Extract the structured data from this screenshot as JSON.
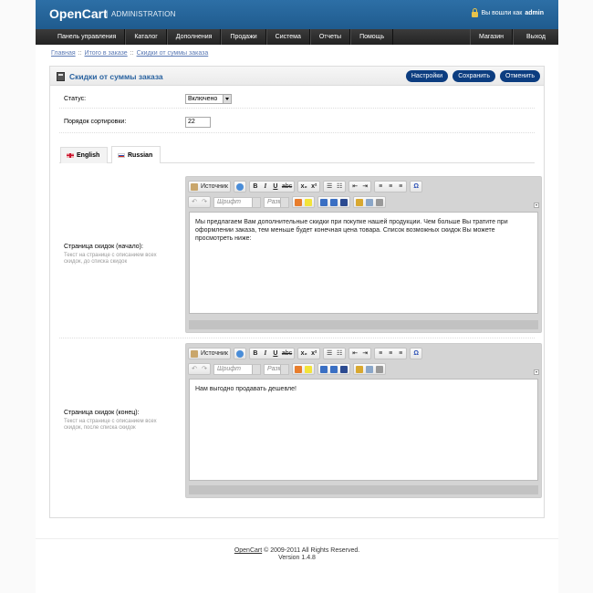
{
  "header": {
    "logo": "OpenCart",
    "logo_sep": "|",
    "logo_sub": "ADMINISTRATION",
    "logged_prefix": "Вы вошли как",
    "logged_user": "admin"
  },
  "menu": {
    "left": [
      "Панель управления",
      "Каталог",
      "Дополнения",
      "Продажи",
      "Система",
      "Отчеты",
      "Помощь"
    ],
    "right": [
      "Магазин",
      "Выход"
    ]
  },
  "breadcrumb": {
    "items": [
      "Главная",
      "Итого в заказе",
      "Скидки от суммы заказа"
    ],
    "separator": "::"
  },
  "box": {
    "title": "Скидки от суммы заказа",
    "buttons": {
      "settings": "Настройки",
      "save": "Сохранить",
      "cancel": "Отменить"
    }
  },
  "form": {
    "status_label": "Статус:",
    "status_value": "Включено",
    "sort_label": "Порядок сортировки:",
    "sort_value": "22"
  },
  "tabs": {
    "english": "English",
    "russian": "Russian"
  },
  "editor_top": {
    "label": "Страница скидок (начало):",
    "help": "Текст на странице с описанием всех скидок, до списка скидок",
    "content": "Мы предлагаем Вам дополнительные скидки при покупке нашей продукции. Чем больше Вы тратите при оформлении заказа, тем меньше будет конечная цена товара. Список возможных скидок Вы можете просмотреть ниже:"
  },
  "editor_bottom": {
    "label": "Страница скидок (конец):",
    "help": "Текст на странице с описанием всех скидок, после списка скидок",
    "content": "Нам выгодно продавать дешевле!"
  },
  "toolbar": {
    "source": "Источник",
    "font": "Шрифт",
    "size": "Разм"
  },
  "footer": {
    "brand": "OpenCart",
    "copyright": "© 2009-2011 All Rights Reserved.",
    "version": "Version 1.4.8"
  },
  "colors": {
    "header_blue": "#2d6fa6",
    "button_navy": "#0c3d80",
    "title_blue": "#2a63a0",
    "link_blue": "#5a79b4"
  }
}
